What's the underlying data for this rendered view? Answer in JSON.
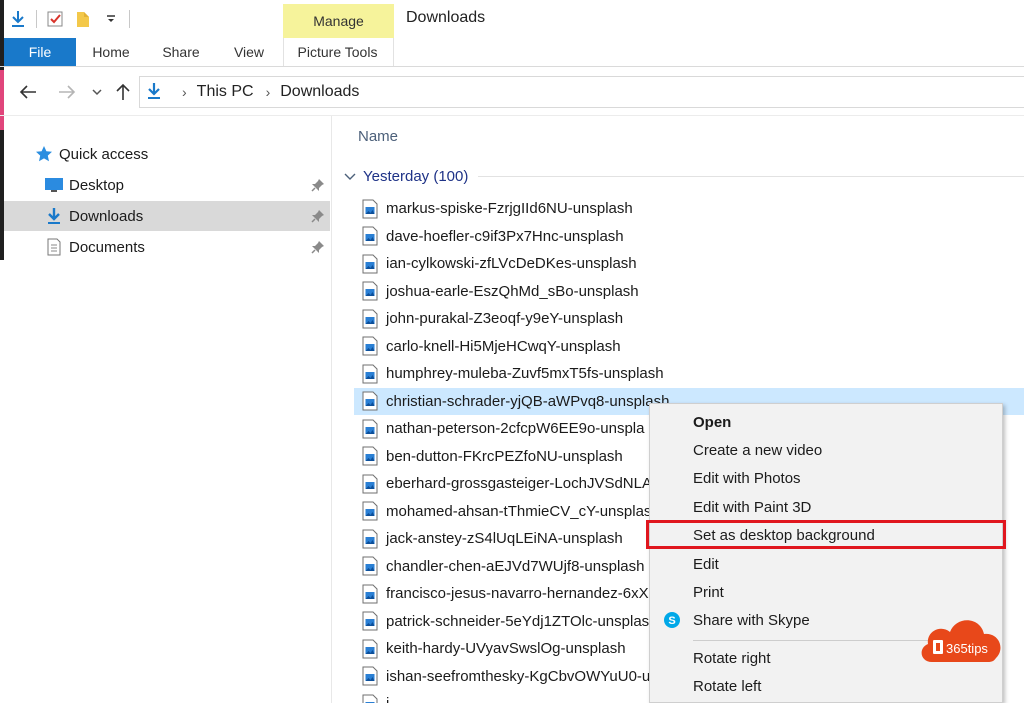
{
  "window": {
    "title": "Downloads"
  },
  "ribbon": {
    "contextual_group": "Manage",
    "tabs": [
      {
        "label": "File"
      },
      {
        "label": "Home"
      },
      {
        "label": "Share"
      },
      {
        "label": "View"
      },
      {
        "label": "Picture Tools"
      }
    ]
  },
  "address": {
    "crumbs": [
      "This PC",
      "Downloads"
    ]
  },
  "nav_pane": {
    "quick_access": "Quick access",
    "items": [
      {
        "label": "Desktop",
        "icon": "desktop-icon",
        "pinned": true
      },
      {
        "label": "Downloads",
        "icon": "downloads-icon",
        "pinned": true,
        "selected": true
      },
      {
        "label": "Documents",
        "icon": "documents-icon",
        "pinned": true
      }
    ]
  },
  "file_list": {
    "column_name": "Name",
    "group_label": "Yesterday (100)",
    "files": [
      "markus-spiske-FzrjgIId6NU-unsplash",
      "dave-hoefler-c9if3Px7Hnc-unsplash",
      "ian-cylkowski-zfLVcDeDKes-unsplash",
      "joshua-earle-EszQhMd_sBo-unsplash",
      "john-purakal-Z3eoqf-y9eY-unsplash",
      "carlo-knell-Hi5MjeHCwqY-unsplash",
      "humphrey-muleba-Zuvf5mxT5fs-unsplash",
      "christian-schrader-yjQB-aWPvq8-unsplash",
      "nathan-peterson-2cfcpW6EE9o-unspla",
      "ben-dutton-FKrcPEZfoNU-unsplash",
      "eberhard-grossgasteiger-LochJVSdNLA",
      "mohamed-ahsan-tThmieCV_cY-unsplas",
      "jack-anstey-zS4lUqLEiNA-unsplash",
      "chandler-chen-aEJVd7WUjf8-unsplash",
      "francisco-jesus-navarro-hernandez-6xX",
      "patrick-schneider-5eYdj1ZTOlc-unsplash",
      "keith-hardy-UVyavSwslOg-unsplash",
      "ishan-seefromthesky-KgCbvOWYuU0-u",
      "i"
    ],
    "selected_file": "christian-schrader-yjQB-aWPvq8-unsplash"
  },
  "context_menu": {
    "items": [
      {
        "label": "Open"
      },
      {
        "label": "Create a new video"
      },
      {
        "label": "Edit with Photos"
      },
      {
        "label": "Edit with Paint 3D"
      },
      {
        "label": "Set as desktop background",
        "highlighted": true
      },
      {
        "label": "Edit"
      },
      {
        "label": "Print"
      },
      {
        "label": "Share with Skype",
        "icon": "skype-icon"
      },
      {
        "label": "Rotate right"
      },
      {
        "label": "Rotate left"
      }
    ]
  },
  "watermark": {
    "text": "365tips"
  },
  "colors": {
    "file_tab": "#1979ca",
    "contextual_group": "#f6f39b",
    "selection": "#cce8ff",
    "highlight_box": "#e0161e",
    "watermark": "#e8481a"
  }
}
